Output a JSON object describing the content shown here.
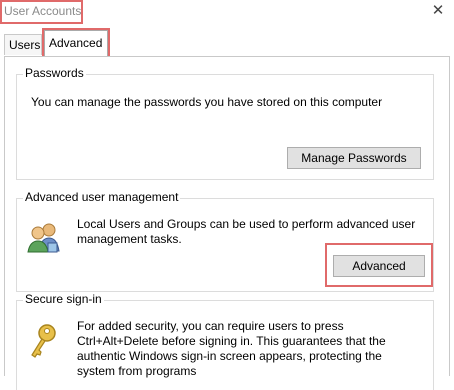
{
  "window": {
    "title": "User Accounts",
    "close_glyph": "✕"
  },
  "tabs": [
    {
      "label": "Users"
    },
    {
      "label": "Advanced"
    }
  ],
  "passwords": {
    "heading": "Passwords",
    "description": "You can manage the passwords you have stored on this computer",
    "button_label": "Manage Passwords"
  },
  "advanced_user_management": {
    "heading": "Advanced user management",
    "description": "Local Users and Groups can be used to perform advanced user management tasks.",
    "button_label": "Advanced",
    "icon": "users-groups-icon"
  },
  "secure_signin": {
    "heading": "Secure sign-in",
    "description": "For added security, you can require users to press Ctrl+Alt+Delete before signing in. This guarantees that the authentic Windows sign-in screen appears, protecting the system from programs",
    "icon": "key-icon"
  },
  "colors": {
    "highlight": "#e06a6a",
    "button_bg": "#e1e1e1",
    "border": "#c9c9c9"
  }
}
